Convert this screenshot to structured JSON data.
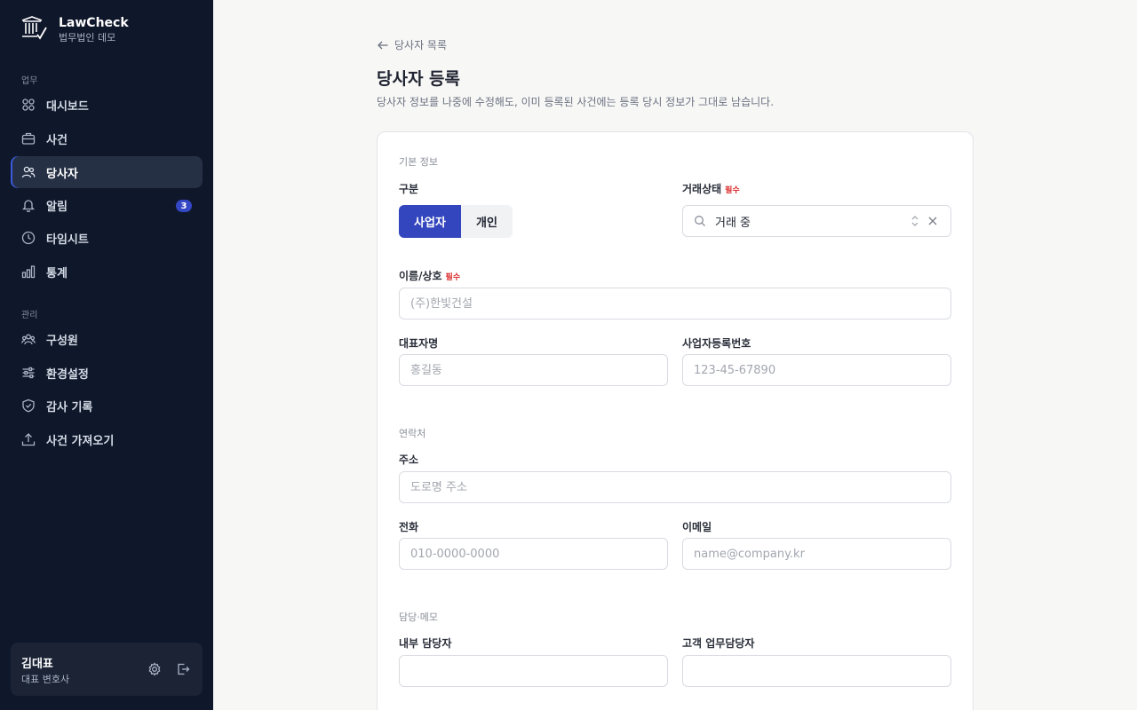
{
  "brand": {
    "name": "LawCheck",
    "subtitle": "법무법인 데모"
  },
  "sidebar": {
    "section_work": "업무",
    "section_admin": "관리",
    "items": [
      {
        "label": "대시보드",
        "icon": "grid-icon"
      },
      {
        "label": "사건",
        "icon": "briefcase-icon"
      },
      {
        "label": "당사자",
        "icon": "users-icon",
        "active": true
      },
      {
        "label": "알림",
        "icon": "bell-icon",
        "badge": "3"
      },
      {
        "label": "타임시트",
        "icon": "clock-icon"
      },
      {
        "label": "통계",
        "icon": "bar-chart-icon"
      },
      {
        "label": "구성원",
        "icon": "team-icon"
      },
      {
        "label": "환경설정",
        "icon": "sliders-icon"
      },
      {
        "label": "감사 기록",
        "icon": "shield-icon"
      },
      {
        "label": "사건 가져오기",
        "icon": "upload-icon"
      }
    ]
  },
  "user": {
    "name": "김대표",
    "role": "대표 변호사"
  },
  "main": {
    "back_label": "당사자 목록",
    "title": "당사자 등록",
    "description": "당사자 정보를 나중에 수정해도, 이미 등록된 사건에는 등록 당시 정보가 그대로 남습니다."
  },
  "form": {
    "group_basic": "기본 정보",
    "group_contact": "연락처",
    "group_memo": "담당·메모",
    "required_tag": "필수",
    "type_label": "구분",
    "type_options": [
      "사업자",
      "개인"
    ],
    "type_selected": "사업자",
    "status_label": "거래상태",
    "status_value": "거래 중",
    "name_label": "이름/상호",
    "name_placeholder": "(주)한빛건설",
    "ceo_label": "대표자명",
    "ceo_placeholder": "홍길동",
    "bizno_label": "사업자등록번호",
    "bizno_placeholder": "123-45-67890",
    "address_label": "주소",
    "address_placeholder": "도로명 주소",
    "phone_label": "전화",
    "phone_placeholder": "010-0000-0000",
    "email_label": "이메일",
    "email_placeholder": "name@company.kr",
    "internal_label": "내부 담당자",
    "client_contact_label": "고객 업무담당자"
  },
  "colors": {
    "sidebar_bg": "#0f172a",
    "accent": "#3346bd",
    "required": "#dc2626"
  }
}
